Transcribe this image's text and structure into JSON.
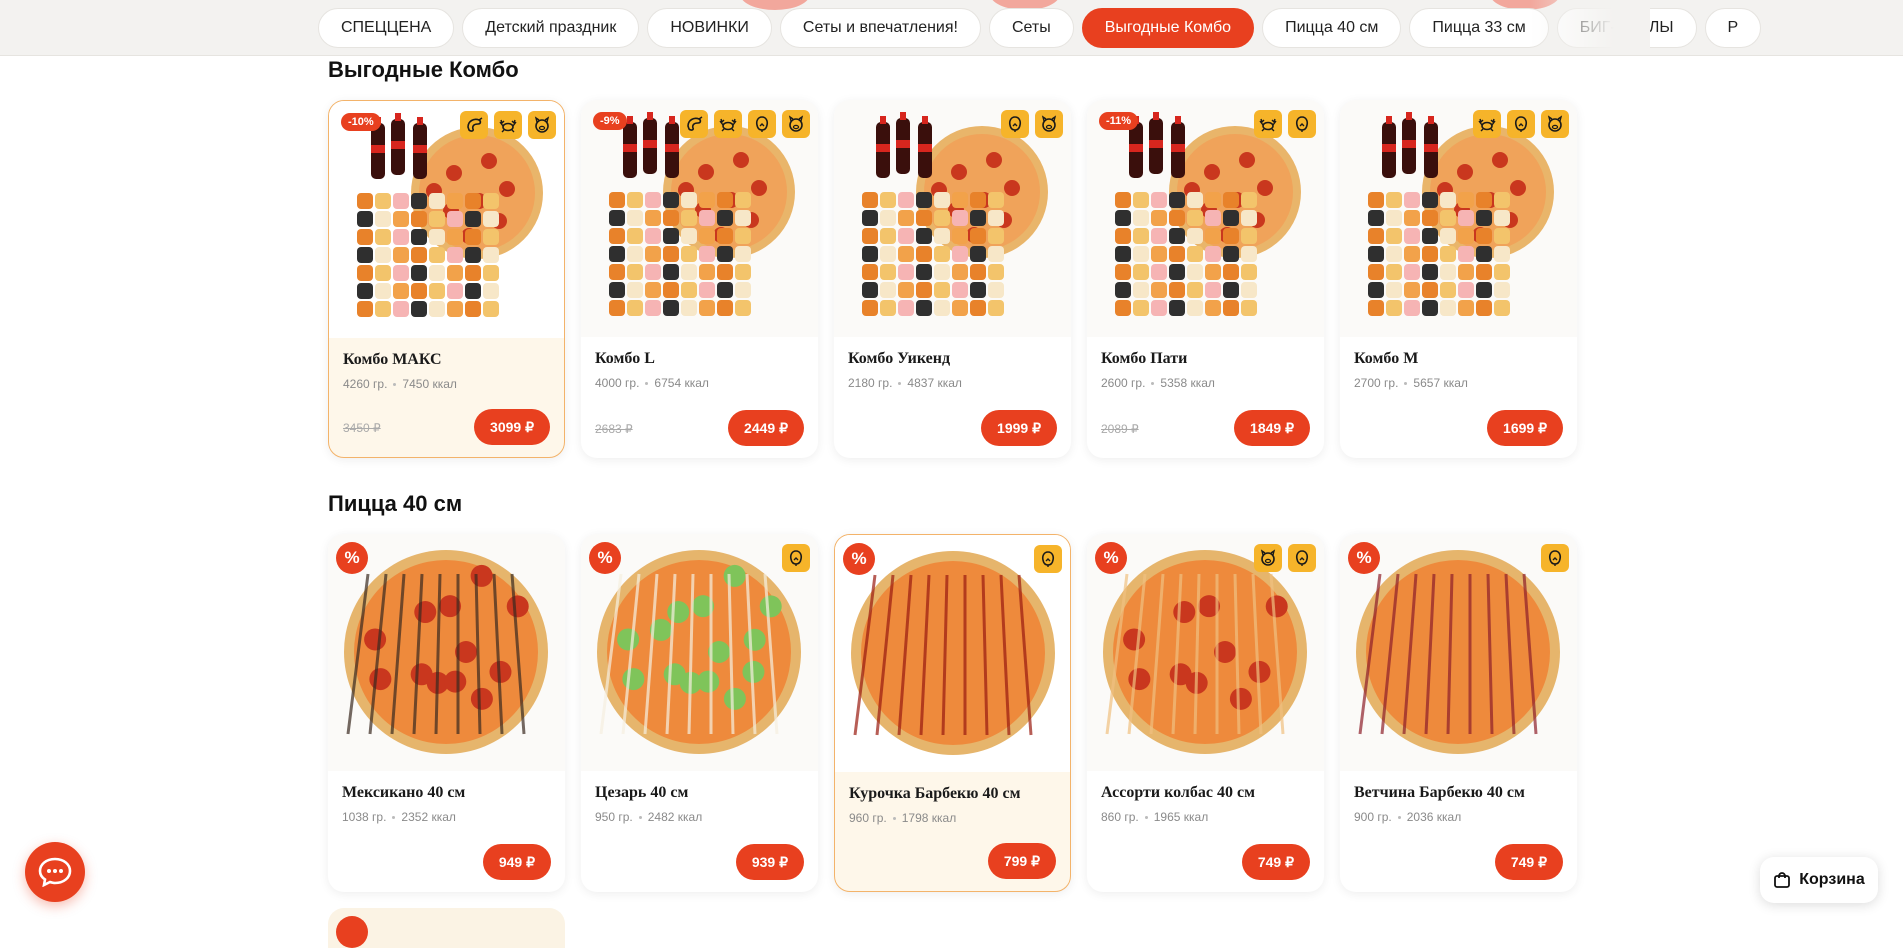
{
  "categories": [
    {
      "label": "СПЕЦЦЕНА",
      "active": false
    },
    {
      "label": "Детский праздник",
      "active": false
    },
    {
      "label": "НОВИНКИ",
      "active": false
    },
    {
      "label": "Сеты и впечатления!",
      "active": false
    },
    {
      "label": "Сеты",
      "active": false
    },
    {
      "label": "Выгодные Комбо",
      "active": true
    },
    {
      "label": "Пицца 40 см",
      "active": false
    },
    {
      "label": "Пицца 33 см",
      "active": false
    },
    {
      "label": "БИГ-РОЛЛЫ",
      "active": false
    },
    {
      "label": "Р",
      "active": false
    }
  ],
  "sections": {
    "combo": {
      "title": "Выгодные Комбо",
      "items": [
        {
          "name": "Комбо МАКС",
          "weight": "4260 гр.",
          "kcal": "7450 ккал",
          "old_price": "3450 ₽",
          "price": "3099 ₽",
          "discount": "-10%",
          "icons": [
            "shrimp-icon",
            "crab-icon",
            "pig-icon"
          ],
          "highlighted": true
        },
        {
          "name": "Комбо L",
          "weight": "4000 гр.",
          "kcal": "6754 ккал",
          "old_price": "2683 ₽",
          "price": "2449 ₽",
          "discount": "-9%",
          "icons": [
            "shrimp-icon",
            "crab-icon",
            "chicken-icon",
            "pig-icon"
          ],
          "highlighted": false
        },
        {
          "name": "Комбо Уикенд",
          "weight": "2180 гр.",
          "kcal": "4837 ккал",
          "old_price": "",
          "price": "1999 ₽",
          "discount": "",
          "icons": [
            "chicken-icon",
            "pig-icon"
          ],
          "highlighted": false
        },
        {
          "name": "Комбо Пати",
          "weight": "2600 гр.",
          "kcal": "5358 ккал",
          "old_price": "2089 ₽",
          "price": "1849 ₽",
          "discount": "-11%",
          "icons": [
            "crab-icon",
            "chicken-icon"
          ],
          "highlighted": false
        },
        {
          "name": "Комбо М",
          "weight": "2700 гр.",
          "kcal": "5657 ккал",
          "old_price": "",
          "price": "1699 ₽",
          "discount": "",
          "icons": [
            "crab-icon",
            "chicken-icon",
            "pig-icon"
          ],
          "highlighted": false
        }
      ]
    },
    "pizza40": {
      "title": "Пицца 40 см",
      "items": [
        {
          "name": "Мексикано 40 см",
          "weight": "1038 гр.",
          "kcal": "2352 ккал",
          "price": "949 ₽",
          "promo": "%",
          "icons": [],
          "highlighted": false
        },
        {
          "name": "Цезарь 40 см",
          "weight": "950 гр.",
          "kcal": "2482 ккал",
          "price": "939 ₽",
          "promo": "%",
          "icons": [
            "chicken-icon"
          ],
          "highlighted": false
        },
        {
          "name": "Курочка Барбекю 40 см",
          "weight": "960 гр.",
          "kcal": "1798 ккал",
          "price": "799 ₽",
          "promo": "%",
          "icons": [
            "chicken-icon"
          ],
          "highlighted": true
        },
        {
          "name": "Ассорти колбас 40 см",
          "weight": "860 гр.",
          "kcal": "1965 ккал",
          "price": "749 ₽",
          "promo": "%",
          "icons": [
            "pig-icon",
            "chicken-icon"
          ],
          "highlighted": false
        },
        {
          "name": "Ветчина Барбекю 40 см",
          "weight": "900 гр.",
          "kcal": "2036 ккал",
          "price": "749 ₽",
          "promo": "%",
          "icons": [
            "chicken-icon"
          ],
          "highlighted": false
        }
      ]
    }
  },
  "cart": {
    "label": "Корзина"
  },
  "colors": {
    "accent": "#e8401f",
    "icon_bg": "#f6b42a",
    "highlight_bg": "#fef7ea"
  }
}
